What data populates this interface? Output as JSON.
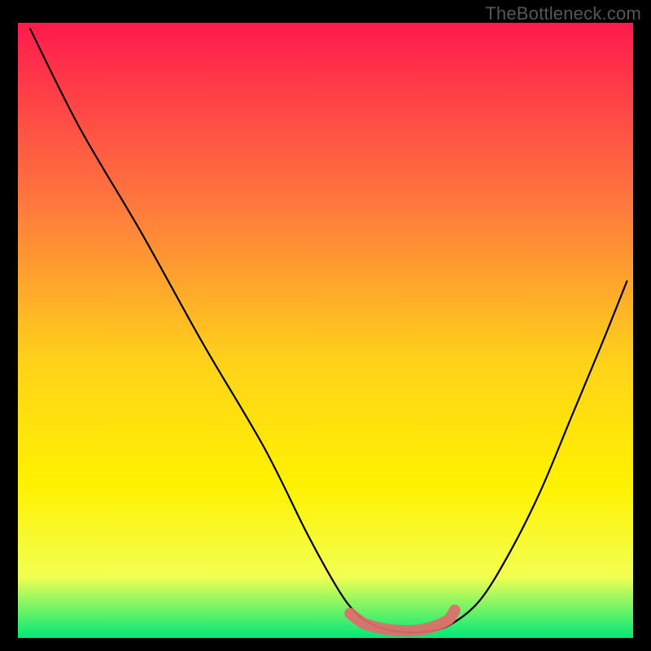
{
  "watermark": "TheBottleneck.com",
  "colors": {
    "grad_top": "#ff1a4d",
    "grad_mid_upper": "#ff7a3d",
    "grad_mid": "#ffd21a",
    "grad_mid_lower": "#fff200",
    "grad_lower": "#f2ff52",
    "grad_bottom": "#00e878",
    "curve": "#000000",
    "marker": "#e16b6b",
    "frame": "#000000"
  },
  "chart_data": {
    "type": "line",
    "title": "",
    "xlabel": "",
    "ylabel": "",
    "xlim": [
      0,
      100
    ],
    "ylim": [
      0,
      100
    ],
    "note": "values are distance-from-bottom as percent of plot height; x as percent of plot width",
    "series": [
      {
        "name": "bottleneck-curve",
        "x": [
          2,
          10,
          20,
          30,
          40,
          47,
          52,
          55,
          58,
          62,
          66,
          70,
          75,
          80,
          85,
          90,
          95,
          99
        ],
        "y": [
          99,
          83,
          66,
          48,
          31,
          17,
          8,
          4,
          2,
          1,
          1,
          2,
          6,
          14,
          24,
          36,
          48,
          58
        ]
      }
    ],
    "markers": {
      "name": "highlight-band",
      "x": [
        54,
        56,
        58,
        60,
        62,
        64,
        66,
        68,
        70,
        71
      ],
      "y": [
        4,
        2.5,
        1.8,
        1.4,
        1.2,
        1.2,
        1.4,
        2,
        3,
        4.5
      ]
    }
  }
}
